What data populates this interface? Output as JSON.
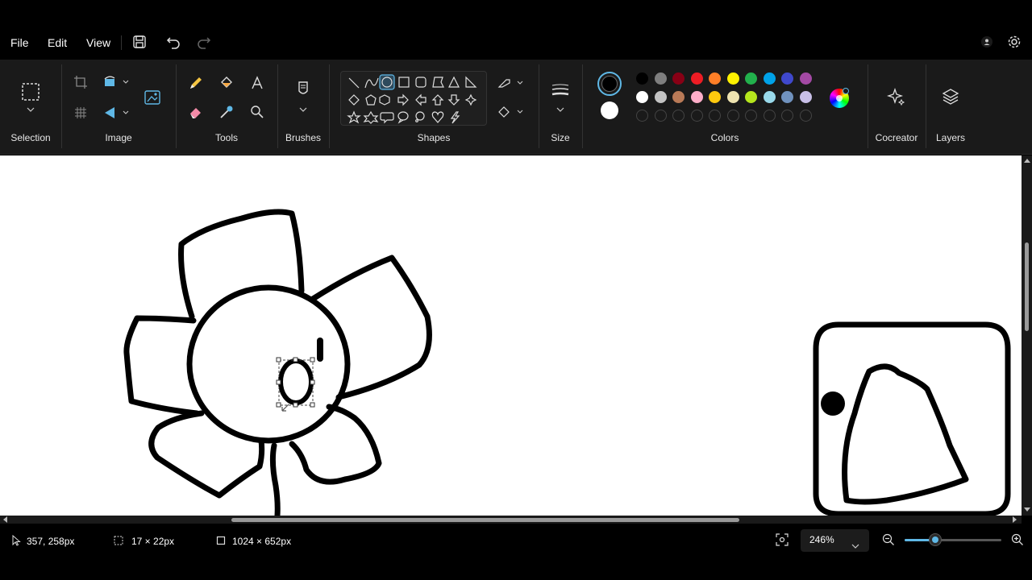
{
  "menu": {
    "file": "File",
    "edit": "Edit",
    "view": "View"
  },
  "ribbon": {
    "groups": {
      "selection": "Selection",
      "image": "Image",
      "tools": "Tools",
      "brushes": "Brushes",
      "shapes": "Shapes",
      "size": "Size",
      "colors": "Colors",
      "cocreator": "Cocreator",
      "layers": "Layers"
    },
    "colors": {
      "primary": "#000000",
      "secondary": "#ffffff",
      "palette_row1": [
        "#000000",
        "#7f7f7f",
        "#880015",
        "#ed1c24",
        "#ff7f27",
        "#fff200",
        "#22b14c",
        "#00a2e8",
        "#3f48cc",
        "#a349a4"
      ],
      "palette_row2": [
        "#ffffff",
        "#c3c3c3",
        "#b97a57",
        "#ffaec9",
        "#ffc90e",
        "#efe4b0",
        "#b5e61d",
        "#99d9ea",
        "#7092be",
        "#c8bfe7"
      ]
    }
  },
  "status": {
    "cursor_position": "357, 258px",
    "selection_size": "17 × 22px",
    "canvas_size": "1024 × 652px",
    "zoom_level": "246%",
    "zoom_slider_fraction": 0.32
  }
}
